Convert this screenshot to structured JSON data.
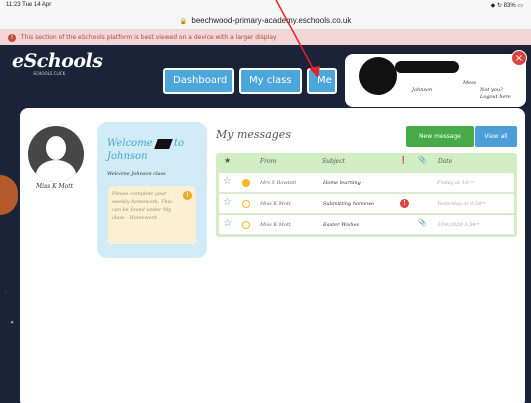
{
  "statusbar": {
    "time": "11:23  Tue 14 Apr",
    "battery": "◆  ↻ 83% ▭"
  },
  "browser": {
    "url": "beechwood-primary-academy.eschools.co.uk"
  },
  "banner": {
    "text": "This section of the eSchools platform is best viewed on a device with a larger display"
  },
  "brand": {
    "logo": "eSchools",
    "tagline": "SCHOOLS CLICK"
  },
  "nav": {
    "dashboard": "Dashboard",
    "myclass": "My class",
    "me": "Me"
  },
  "popup": {
    "surname": "Johnson",
    "mess": "Mess",
    "logout": "Not you? Logout here",
    "close": "×"
  },
  "profile": {
    "teacher_name": "Miss K Mott"
  },
  "welcome": {
    "title_before": "Welcome",
    "title_after": "to",
    "title_name": "Johnson",
    "subtitle": "Welcome Johnson class",
    "note": "Please complete your weekly homework. This can be found under My class - Homework",
    "note_icon": "!"
  },
  "messages": {
    "title": "My messages",
    "new_btn": "New message",
    "view_btn": "View all",
    "columns": {
      "from": "From",
      "subject": "Subject",
      "date": "Date"
    },
    "rows": [
      {
        "from": "Mrs S Rowlett",
        "subject": "Home learning -",
        "date": "Friday at 10:ᵒᵐ",
        "unread": true,
        "alert": false,
        "attach": false
      },
      {
        "from": "Miss K Mott",
        "subject": "Submitting homewo",
        "date": "Yesterday at 9:58ᵒᵐ",
        "unread": false,
        "alert": true,
        "attach": false
      },
      {
        "from": "Miss K Mott",
        "subject": "Easter Wishes",
        "date": "3/04/2020 3:54ᵖᵐ",
        "unread": false,
        "alert": false,
        "attach": true
      }
    ]
  },
  "colors": {
    "accent": "#4ca6d9",
    "new_message": "#46ab47",
    "view_all": "#4b9fd9",
    "alert": "#d9453d"
  }
}
